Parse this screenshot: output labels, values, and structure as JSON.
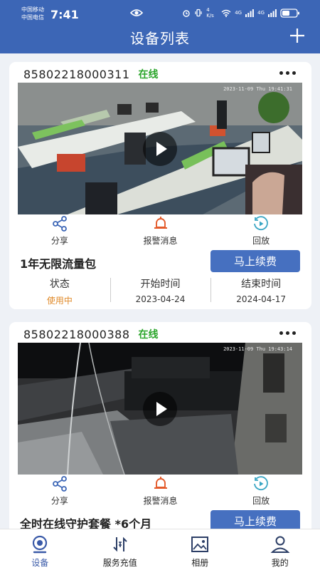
{
  "statusbar": {
    "carrier1": "中国移动",
    "carrier2": "中国电信",
    "time": "7:41",
    "speed": "4 K/s",
    "net1": "4G",
    "net2": "4G"
  },
  "header": {
    "title": "设备列表"
  },
  "devices": [
    {
      "id": "85802218000311",
      "status": "在线",
      "video_timestamp": "2023-11-09 Thu 19:41:31",
      "actions": [
        "分享",
        "报警消息",
        "回放"
      ],
      "plan": "1年无限流量包",
      "renew_label": "马上续费",
      "info_labels": [
        "状态",
        "开始时间",
        "结束时间"
      ],
      "info_values": [
        "使用中",
        "2023-04-24",
        "2024-04-17"
      ]
    },
    {
      "id": "85802218000388",
      "status": "在线",
      "video_timestamp": "2023-11-09 Thu 19:43:14",
      "actions": [
        "分享",
        "报警消息",
        "回放"
      ],
      "plan": "全时在线守护套餐 *6个月",
      "renew_label": "马上续费"
    }
  ],
  "tabs": [
    "设备",
    "服务充值",
    "相册",
    "我的"
  ],
  "colors": {
    "brand": "#3c66b6",
    "online": "#2ba52b",
    "in_use": "#e08a2a",
    "alarm": "#e45a2a",
    "button": "#4670c0"
  },
  "icons": [
    "eye-icon",
    "plus-icon",
    "more-icon",
    "share-icon",
    "bell-icon",
    "playback-icon",
    "play-icon",
    "camera-icon",
    "recharge-icon",
    "album-icon",
    "user-icon"
  ]
}
